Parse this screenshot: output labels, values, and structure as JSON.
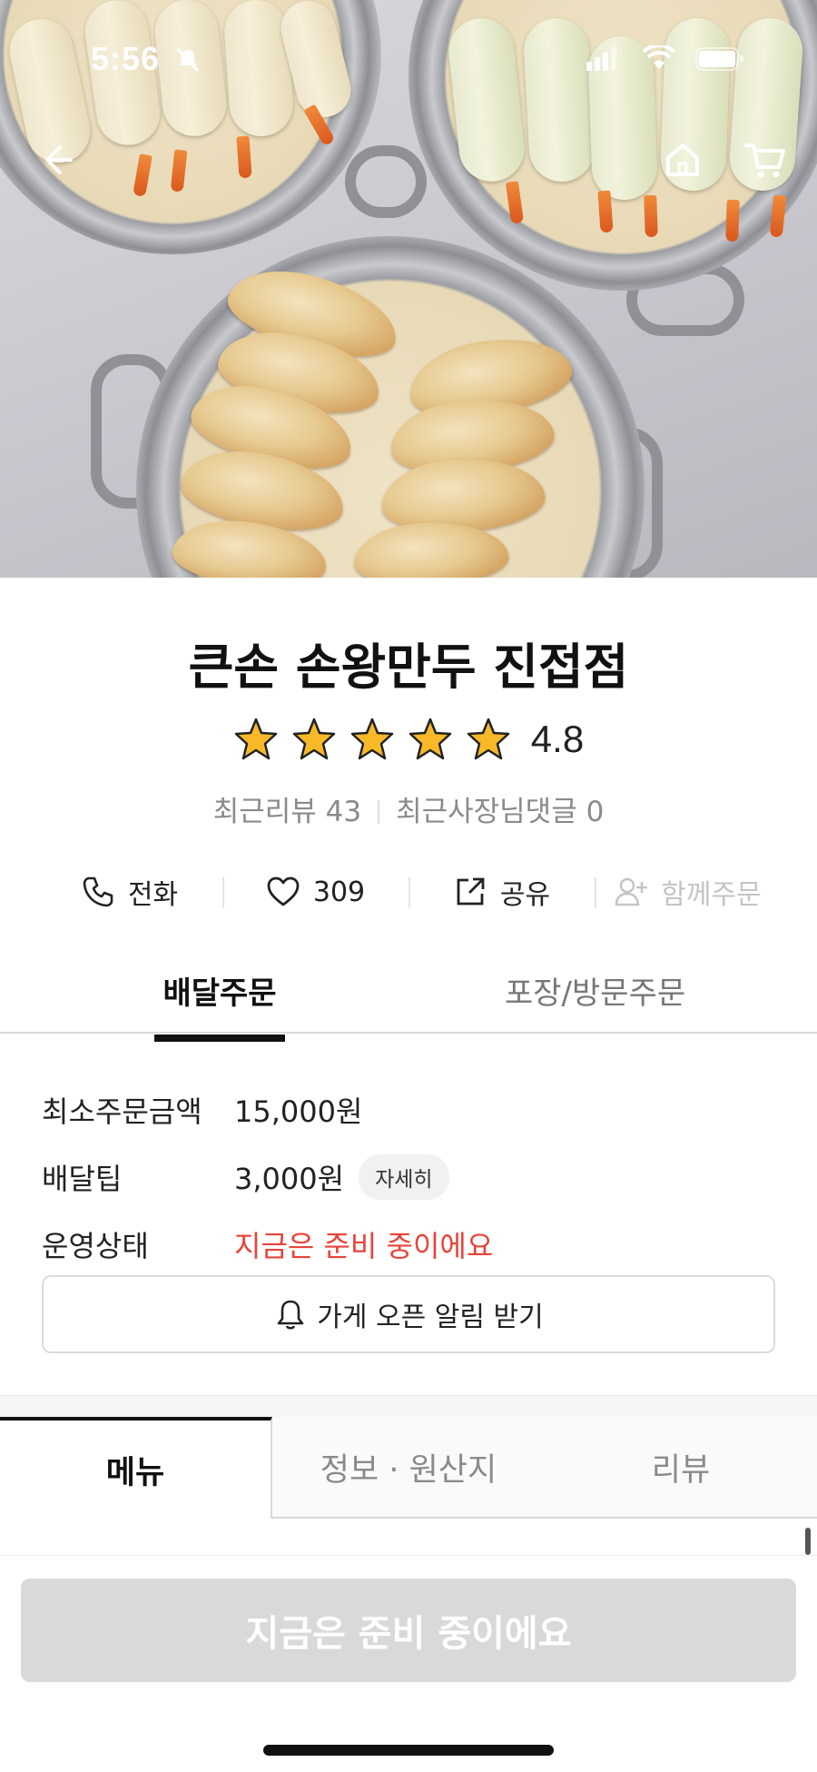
{
  "status_bar": {
    "time": "5:56"
  },
  "store": {
    "name": "큰손 손왕만두 진접점",
    "rating": "4.8",
    "stars": 5,
    "recent_reviews": "최근리뷰 43",
    "owner_replies": "최근사장님댓글 0"
  },
  "actions": {
    "call": "전화",
    "like_count": "309",
    "share": "공유",
    "group_order": "함께주문"
  },
  "order_tabs": {
    "delivery": "배달주문",
    "pickup": "포장/방문주문"
  },
  "info": {
    "min_order_label": "최소주문금액",
    "min_order_value": "15,000원",
    "delivery_tip_label": "배달팁",
    "delivery_tip_value": "3,000원",
    "detail_chip": "자세히",
    "status_label": "운영상태",
    "status_value": "지금은 준비 중이에요"
  },
  "alarm_button": "가게 오픈 알림 받기",
  "menu_tabs": {
    "menu": "메뉴",
    "info": "정보 · 원산지",
    "review": "리뷰"
  },
  "bottom_button": "지금은 준비 중이에요",
  "colors": {
    "accent_red": "#e8443a",
    "star_yellow": "#f7b928",
    "disabled_gray": "#d9d9d9"
  },
  "icons": [
    "back-arrow-icon",
    "home-icon",
    "cart-icon",
    "phone-icon",
    "heart-icon",
    "share-icon",
    "add-person-icon",
    "bell-icon",
    "star-icon"
  ]
}
